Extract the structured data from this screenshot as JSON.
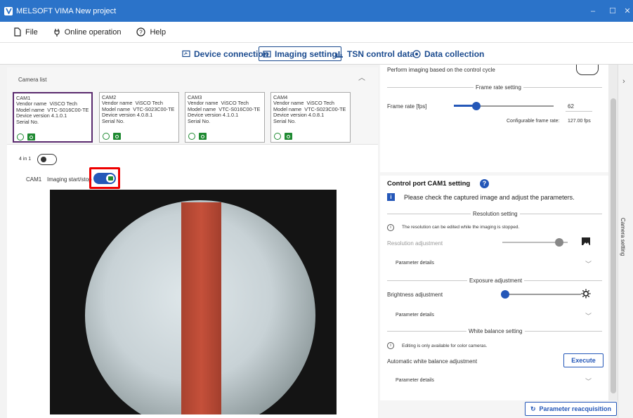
{
  "window": {
    "title": "MELSOFT VIMA New project",
    "minimize": "–",
    "maximize": "☐",
    "close": "✕"
  },
  "menu": {
    "file": "File",
    "online": "Online operation",
    "help": "Help"
  },
  "tabs": [
    {
      "label": "Device connection"
    },
    {
      "label": "Imaging setting"
    },
    {
      "label": "TSN control data"
    },
    {
      "label": "Data collection"
    }
  ],
  "camera_list": {
    "title": "Camera list",
    "cards": [
      {
        "name": "CAM1",
        "vendor_label": "Vendor name",
        "vendor": "ViSCO Tech",
        "model_label": "Model name",
        "model": "VTC-S016C00-TE",
        "version_label": "Device version",
        "version": "4.1.0.1",
        "serial_label": "Serial No."
      },
      {
        "name": "CAM2",
        "vendor_label": "Vendor name",
        "vendor": "ViSCO Tech",
        "model_label": "Model name",
        "model": "VTC-S023C00-TE",
        "version_label": "Device version",
        "version": "4.0.8.1",
        "serial_label": "Serial No."
      },
      {
        "name": "CAM3",
        "vendor_label": "Vendor name",
        "vendor": "ViSCO Tech",
        "model_label": "Model name",
        "model": "VTC-S016C00-TE",
        "version_label": "Device version",
        "version": "4.1.0.1",
        "serial_label": "Serial No."
      },
      {
        "name": "CAM4",
        "vendor_label": "Vendor name",
        "vendor": "ViSCO Tech",
        "model_label": "Model name",
        "model": "VTC-S023C00-TE",
        "version_label": "Device version",
        "version": "4.0.8.1",
        "serial_label": "Serial No."
      }
    ]
  },
  "fourinone": {
    "label": "4 in 1"
  },
  "imaging": {
    "cam": "CAM1",
    "label": "Imaging start/stop"
  },
  "right": {
    "perform_label": "Perform imaging based on the control cycle",
    "frame_rate_section": "Frame rate setting",
    "frame_rate_label": "Frame rate [fps]",
    "frame_rate_value": "62",
    "configurable_label": "Configurable frame rate:",
    "configurable_value": "127.00 fps",
    "control_port_title": "Control port CAM1 setting",
    "notice": "Please check the captured image and adjust the parameters.",
    "resolution_section": "Resolution setting",
    "resolution_info": "The resolution can be edited while the imaging is stopped.",
    "resolution_adjust": "Resolution adjustment",
    "param_details": "Parameter details",
    "exposure_section": "Exposure adjustment",
    "brightness": "Brightness adjustment",
    "wb_section": "White balance setting",
    "wb_info": "Editing is only available for color cameras.",
    "auto_wb": "Automatic white balance adjustment",
    "execute": "Execute",
    "reacquire": "Parameter reacquisition"
  },
  "side_tab": "Camera setting",
  "colors": {
    "accent": "#2457b8",
    "titlebar": "#2b73c9",
    "ok_green": "#1f8a32",
    "highlight": "#e00000"
  }
}
